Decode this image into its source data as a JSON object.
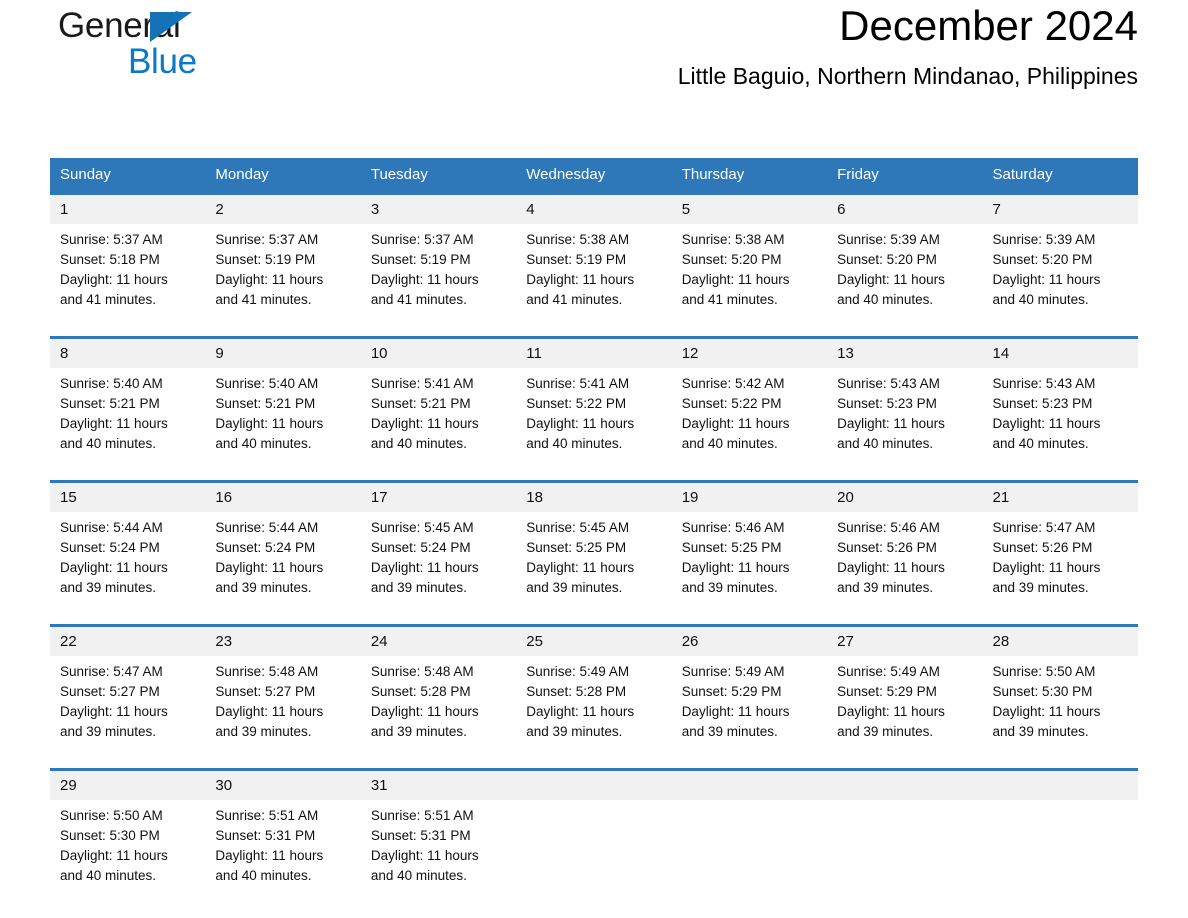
{
  "brand": {
    "name_part1": "General",
    "name_part2": "Blue",
    "triangle_color": "#1572b6",
    "blue_color": "#0b78c8"
  },
  "header": {
    "title": "December 2024",
    "subtitle": "Little Baguio, Northern Mindanao, Philippines"
  },
  "calendar": {
    "header_bg": "#2e77b8",
    "daynum_bg": "#f1f1f1",
    "weekdays": [
      "Sunday",
      "Monday",
      "Tuesday",
      "Wednesday",
      "Thursday",
      "Friday",
      "Saturday"
    ],
    "weeks": [
      [
        {
          "day": "1",
          "sunrise": "Sunrise: 5:37 AM",
          "sunset": "Sunset: 5:18 PM",
          "daylight1": "Daylight: 11 hours",
          "daylight2": "and 41 minutes."
        },
        {
          "day": "2",
          "sunrise": "Sunrise: 5:37 AM",
          "sunset": "Sunset: 5:19 PM",
          "daylight1": "Daylight: 11 hours",
          "daylight2": "and 41 minutes."
        },
        {
          "day": "3",
          "sunrise": "Sunrise: 5:37 AM",
          "sunset": "Sunset: 5:19 PM",
          "daylight1": "Daylight: 11 hours",
          "daylight2": "and 41 minutes."
        },
        {
          "day": "4",
          "sunrise": "Sunrise: 5:38 AM",
          "sunset": "Sunset: 5:19 PM",
          "daylight1": "Daylight: 11 hours",
          "daylight2": "and 41 minutes."
        },
        {
          "day": "5",
          "sunrise": "Sunrise: 5:38 AM",
          "sunset": "Sunset: 5:20 PM",
          "daylight1": "Daylight: 11 hours",
          "daylight2": "and 41 minutes."
        },
        {
          "day": "6",
          "sunrise": "Sunrise: 5:39 AM",
          "sunset": "Sunset: 5:20 PM",
          "daylight1": "Daylight: 11 hours",
          "daylight2": "and 40 minutes."
        },
        {
          "day": "7",
          "sunrise": "Sunrise: 5:39 AM",
          "sunset": "Sunset: 5:20 PM",
          "daylight1": "Daylight: 11 hours",
          "daylight2": "and 40 minutes."
        }
      ],
      [
        {
          "day": "8",
          "sunrise": "Sunrise: 5:40 AM",
          "sunset": "Sunset: 5:21 PM",
          "daylight1": "Daylight: 11 hours",
          "daylight2": "and 40 minutes."
        },
        {
          "day": "9",
          "sunrise": "Sunrise: 5:40 AM",
          "sunset": "Sunset: 5:21 PM",
          "daylight1": "Daylight: 11 hours",
          "daylight2": "and 40 minutes."
        },
        {
          "day": "10",
          "sunrise": "Sunrise: 5:41 AM",
          "sunset": "Sunset: 5:21 PM",
          "daylight1": "Daylight: 11 hours",
          "daylight2": "and 40 minutes."
        },
        {
          "day": "11",
          "sunrise": "Sunrise: 5:41 AM",
          "sunset": "Sunset: 5:22 PM",
          "daylight1": "Daylight: 11 hours",
          "daylight2": "and 40 minutes."
        },
        {
          "day": "12",
          "sunrise": "Sunrise: 5:42 AM",
          "sunset": "Sunset: 5:22 PM",
          "daylight1": "Daylight: 11 hours",
          "daylight2": "and 40 minutes."
        },
        {
          "day": "13",
          "sunrise": "Sunrise: 5:43 AM",
          "sunset": "Sunset: 5:23 PM",
          "daylight1": "Daylight: 11 hours",
          "daylight2": "and 40 minutes."
        },
        {
          "day": "14",
          "sunrise": "Sunrise: 5:43 AM",
          "sunset": "Sunset: 5:23 PM",
          "daylight1": "Daylight: 11 hours",
          "daylight2": "and 40 minutes."
        }
      ],
      [
        {
          "day": "15",
          "sunrise": "Sunrise: 5:44 AM",
          "sunset": "Sunset: 5:24 PM",
          "daylight1": "Daylight: 11 hours",
          "daylight2": "and 39 minutes."
        },
        {
          "day": "16",
          "sunrise": "Sunrise: 5:44 AM",
          "sunset": "Sunset: 5:24 PM",
          "daylight1": "Daylight: 11 hours",
          "daylight2": "and 39 minutes."
        },
        {
          "day": "17",
          "sunrise": "Sunrise: 5:45 AM",
          "sunset": "Sunset: 5:24 PM",
          "daylight1": "Daylight: 11 hours",
          "daylight2": "and 39 minutes."
        },
        {
          "day": "18",
          "sunrise": "Sunrise: 5:45 AM",
          "sunset": "Sunset: 5:25 PM",
          "daylight1": "Daylight: 11 hours",
          "daylight2": "and 39 minutes."
        },
        {
          "day": "19",
          "sunrise": "Sunrise: 5:46 AM",
          "sunset": "Sunset: 5:25 PM",
          "daylight1": "Daylight: 11 hours",
          "daylight2": "and 39 minutes."
        },
        {
          "day": "20",
          "sunrise": "Sunrise: 5:46 AM",
          "sunset": "Sunset: 5:26 PM",
          "daylight1": "Daylight: 11 hours",
          "daylight2": "and 39 minutes."
        },
        {
          "day": "21",
          "sunrise": "Sunrise: 5:47 AM",
          "sunset": "Sunset: 5:26 PM",
          "daylight1": "Daylight: 11 hours",
          "daylight2": "and 39 minutes."
        }
      ],
      [
        {
          "day": "22",
          "sunrise": "Sunrise: 5:47 AM",
          "sunset": "Sunset: 5:27 PM",
          "daylight1": "Daylight: 11 hours",
          "daylight2": "and 39 minutes."
        },
        {
          "day": "23",
          "sunrise": "Sunrise: 5:48 AM",
          "sunset": "Sunset: 5:27 PM",
          "daylight1": "Daylight: 11 hours",
          "daylight2": "and 39 minutes."
        },
        {
          "day": "24",
          "sunrise": "Sunrise: 5:48 AM",
          "sunset": "Sunset: 5:28 PM",
          "daylight1": "Daylight: 11 hours",
          "daylight2": "and 39 minutes."
        },
        {
          "day": "25",
          "sunrise": "Sunrise: 5:49 AM",
          "sunset": "Sunset: 5:28 PM",
          "daylight1": "Daylight: 11 hours",
          "daylight2": "and 39 minutes."
        },
        {
          "day": "26",
          "sunrise": "Sunrise: 5:49 AM",
          "sunset": "Sunset: 5:29 PM",
          "daylight1": "Daylight: 11 hours",
          "daylight2": "and 39 minutes."
        },
        {
          "day": "27",
          "sunrise": "Sunrise: 5:49 AM",
          "sunset": "Sunset: 5:29 PM",
          "daylight1": "Daylight: 11 hours",
          "daylight2": "and 39 minutes."
        },
        {
          "day": "28",
          "sunrise": "Sunrise: 5:50 AM",
          "sunset": "Sunset: 5:30 PM",
          "daylight1": "Daylight: 11 hours",
          "daylight2": "and 39 minutes."
        }
      ],
      [
        {
          "day": "29",
          "sunrise": "Sunrise: 5:50 AM",
          "sunset": "Sunset: 5:30 PM",
          "daylight1": "Daylight: 11 hours",
          "daylight2": "and 40 minutes."
        },
        {
          "day": "30",
          "sunrise": "Sunrise: 5:51 AM",
          "sunset": "Sunset: 5:31 PM",
          "daylight1": "Daylight: 11 hours",
          "daylight2": "and 40 minutes."
        },
        {
          "day": "31",
          "sunrise": "Sunrise: 5:51 AM",
          "sunset": "Sunset: 5:31 PM",
          "daylight1": "Daylight: 11 hours",
          "daylight2": "and 40 minutes."
        },
        {
          "day": "",
          "sunrise": "",
          "sunset": "",
          "daylight1": "",
          "daylight2": ""
        },
        {
          "day": "",
          "sunrise": "",
          "sunset": "",
          "daylight1": "",
          "daylight2": ""
        },
        {
          "day": "",
          "sunrise": "",
          "sunset": "",
          "daylight1": "",
          "daylight2": ""
        },
        {
          "day": "",
          "sunrise": "",
          "sunset": "",
          "daylight1": "",
          "daylight2": ""
        }
      ]
    ]
  }
}
